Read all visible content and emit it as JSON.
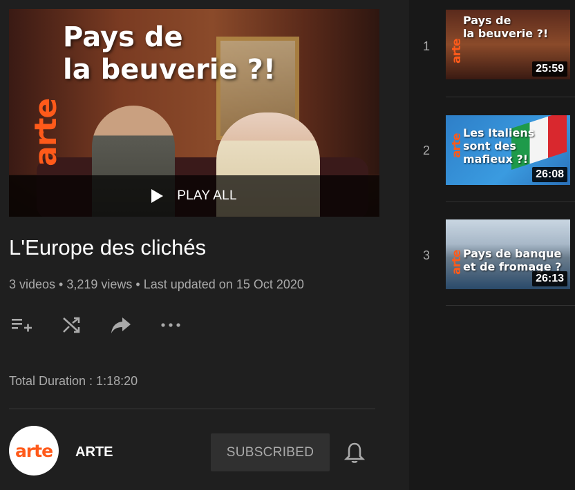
{
  "playlist": {
    "hero_title_line1": "Pays de",
    "hero_title_line2": "la beuverie ?!",
    "hero_brand": "arte",
    "play_all_label": "PLAY ALL",
    "title": "L'Europe des clichés",
    "meta": "3 videos • 3,219 views • Last updated on 15 Oct 2020",
    "total_duration": "Total Duration : 1:18:20",
    "actions": [
      {
        "icon": "add-to-queue-icon"
      },
      {
        "icon": "shuffle-icon"
      },
      {
        "icon": "share-icon"
      },
      {
        "icon": "more-icon"
      }
    ]
  },
  "channel": {
    "avatar_text": "arte",
    "name": "ARTE",
    "subscribe_label": "SUBSCRIBED",
    "bell_icon": "bell-icon"
  },
  "videos": [
    {
      "index": "1",
      "line1": "Pays de",
      "line2": "la beuverie ?!",
      "brand": "arte",
      "duration": "25:59"
    },
    {
      "index": "2",
      "line1": "Les Italiens",
      "line2": "sont des",
      "line3": "mafieux ?!",
      "brand": "arte",
      "duration": "26:08"
    },
    {
      "index": "3",
      "line1": "Pays de banque",
      "line2": "et de fromage ?",
      "brand": "arte",
      "duration": "26:13"
    }
  ],
  "colors": {
    "arte_orange": "#ff5a1a",
    "background": "#1f1f1f",
    "secondary_text": "#aaaaaa"
  }
}
